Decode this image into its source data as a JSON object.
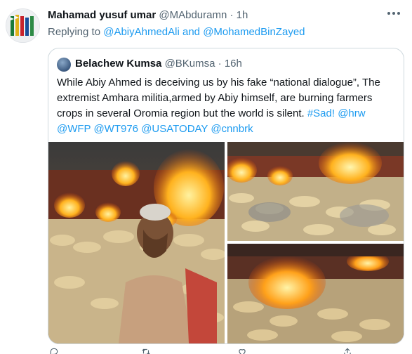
{
  "tweet": {
    "author_name": "Mahamad yusuf umar",
    "author_handle": "@MAbduramn",
    "separator": "·",
    "time": "1h",
    "replying_to_label": "Replying to",
    "mention_1": "@AbiyAhmedAli",
    "and_label": "and",
    "mention_2": "@MohamedBinZayed"
  },
  "quote": {
    "author_name": "Belachew Kumsa",
    "author_handle": "@BKumsa",
    "separator": "·",
    "time": "16h",
    "text": "While Abiy Ahmed is deceiving us by his fake “national dialogue”, The extremist Amhara militia,armed by Abiy himself, are burning farmers crops in several Oromia region but the world is silent.",
    "hashtag": "#Sad!",
    "mentions": "@hrw @WFP @WT976 @USATODAY @cnnbrk"
  },
  "icons": [
    "flag-avatar-icon",
    "more-options-icon",
    "verified-avatar",
    "reply-icon",
    "retweet-icon",
    "like-icon",
    "share-icon"
  ],
  "colors": {
    "link": "#1d9bf0",
    "meta": "#536471",
    "border": "#cfd9de"
  }
}
